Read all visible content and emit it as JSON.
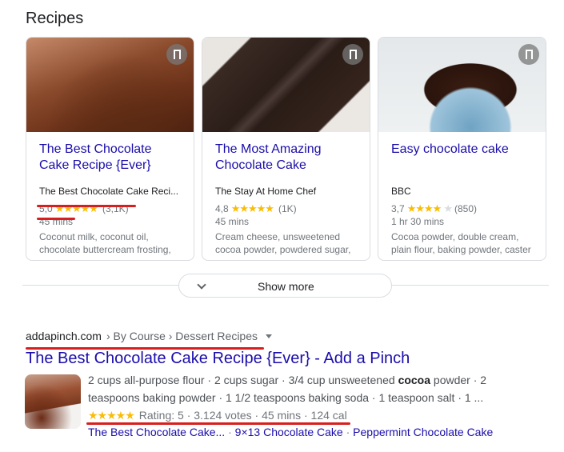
{
  "section": {
    "title": "Recipes"
  },
  "cards": [
    {
      "title": "The Best Chocolate Cake Recipe {Ever}",
      "source": "The Best Chocolate Cake Reci...",
      "rating_value": "5,0",
      "stars_full": "★★★★★",
      "stars_empty": "",
      "rating_count": "(3,1K)",
      "time": "45 mins",
      "ingredients": "Coconut milk, coconut oil, chocolate buttercream frosting,"
    },
    {
      "title": "The Most Amazing Chocolate Cake",
      "source": "The Stay At Home Chef",
      "rating_value": "4,8",
      "stars_full": "★★★★★",
      "stars_empty": "",
      "rating_count": "(1K)",
      "time": "45 mins",
      "ingredients": "Cream cheese, unsweetened cocoa powder, powdered sugar,"
    },
    {
      "title": "Easy chocolate cake",
      "source": "BBC",
      "rating_value": "3,7",
      "stars_full": "★★★★",
      "stars_empty": "★",
      "rating_count": "(850)",
      "time": "1 hr 30 mins",
      "ingredients": "Cocoa powder, double cream, plain flour, baking powder, caster"
    }
  ],
  "show_more": {
    "label": "Show more"
  },
  "result": {
    "domain": "addapinch.com",
    "path": "› By Course › Dessert Recipes",
    "title": "The Best Chocolate Cake Recipe {Ever} - Add a Pinch",
    "snippet_before": "2 cups all-purpose flour · 2 cups sugar · 3/4 cup unsweetened ",
    "snippet_bold": "cocoa",
    "snippet_after": " powder · 2 teaspoons baking powder · 1 1/2 teaspoons baking soda · 1 teaspoon salt · 1 ...",
    "stars": "★★★★★",
    "rating": "Rating: 5 · 3.124 votes · 45 mins · 124 cal",
    "sitelinks": [
      "The Best Chocolate Cake...",
      "9×13 Chocolate Cake",
      "Peppermint Chocolate Cake"
    ],
    "sitelink_sep": " · "
  },
  "colors": {
    "link": "#1a0dab",
    "star": "#fbbc04",
    "annotation": "#d81e1e"
  }
}
